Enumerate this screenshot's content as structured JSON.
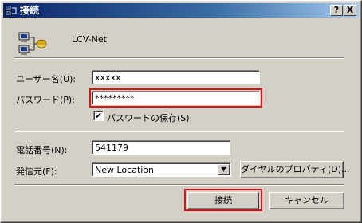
{
  "window": {
    "title": "接続",
    "help_label": "?",
    "close_label": "X"
  },
  "header": {
    "app_name": "LCV-Net"
  },
  "form": {
    "username_label": "ユーザー名(U):",
    "username_value": "xxxxx",
    "password_label": "パスワード(P):",
    "password_value": "*********",
    "save_password_label": "パスワードの保存(S)",
    "save_password_checked": "✔",
    "phone_label": "電話番号(N):",
    "phone_value": "541179",
    "dial_from_label": "発信元(F):",
    "dial_from_value": "New Location",
    "dial_from_arrow": "▼",
    "dial_properties_label": "ダイヤルのプロパティ(D)..."
  },
  "buttons": {
    "connect_label": "接続",
    "cancel_label": "キャンセル"
  },
  "colors": {
    "highlight": "#e01010",
    "titlebar": "#0a246a",
    "face": "#d4d0c8"
  }
}
